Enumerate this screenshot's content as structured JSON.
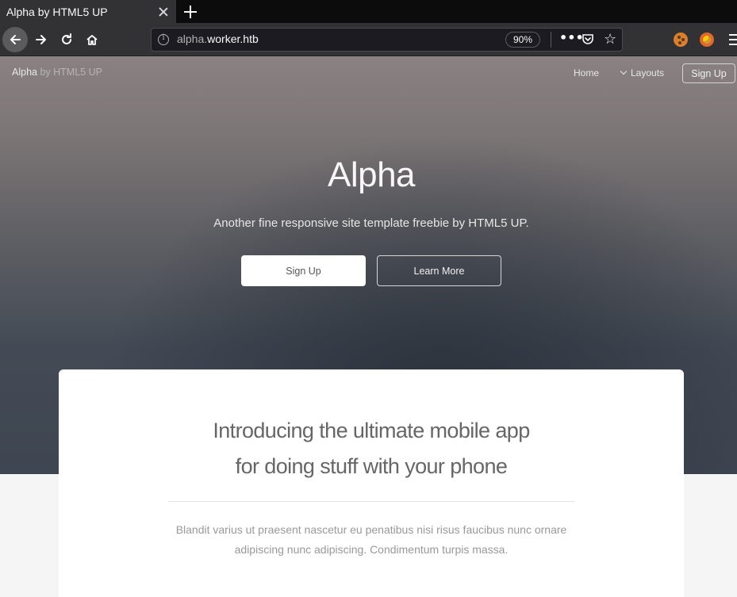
{
  "browser": {
    "tab_title": "Alpha by HTML5 UP",
    "url_prefix": "alpha.",
    "url_host": "worker.htb",
    "zoom": "90%"
  },
  "site": {
    "logo_name": "Alpha",
    "logo_by": " by HTML5 UP",
    "nav": {
      "home": "Home",
      "layouts": "Layouts",
      "signup": "Sign Up"
    }
  },
  "hero": {
    "title": "Alpha",
    "subtitle": "Another fine responsive site template freebie by HTML5 UP.",
    "primary_button": "Sign Up",
    "secondary_button": "Learn More"
  },
  "intro": {
    "title_line1": "Introducing the ultimate mobile app",
    "title_line2": "for doing stuff with your phone",
    "text_line1": "Blandit varius ut praesent nascetur eu penatibus nisi risus faucibus nunc ornare",
    "text_line2": "adipiscing nunc adipiscing. Condimentum turpis massa."
  }
}
